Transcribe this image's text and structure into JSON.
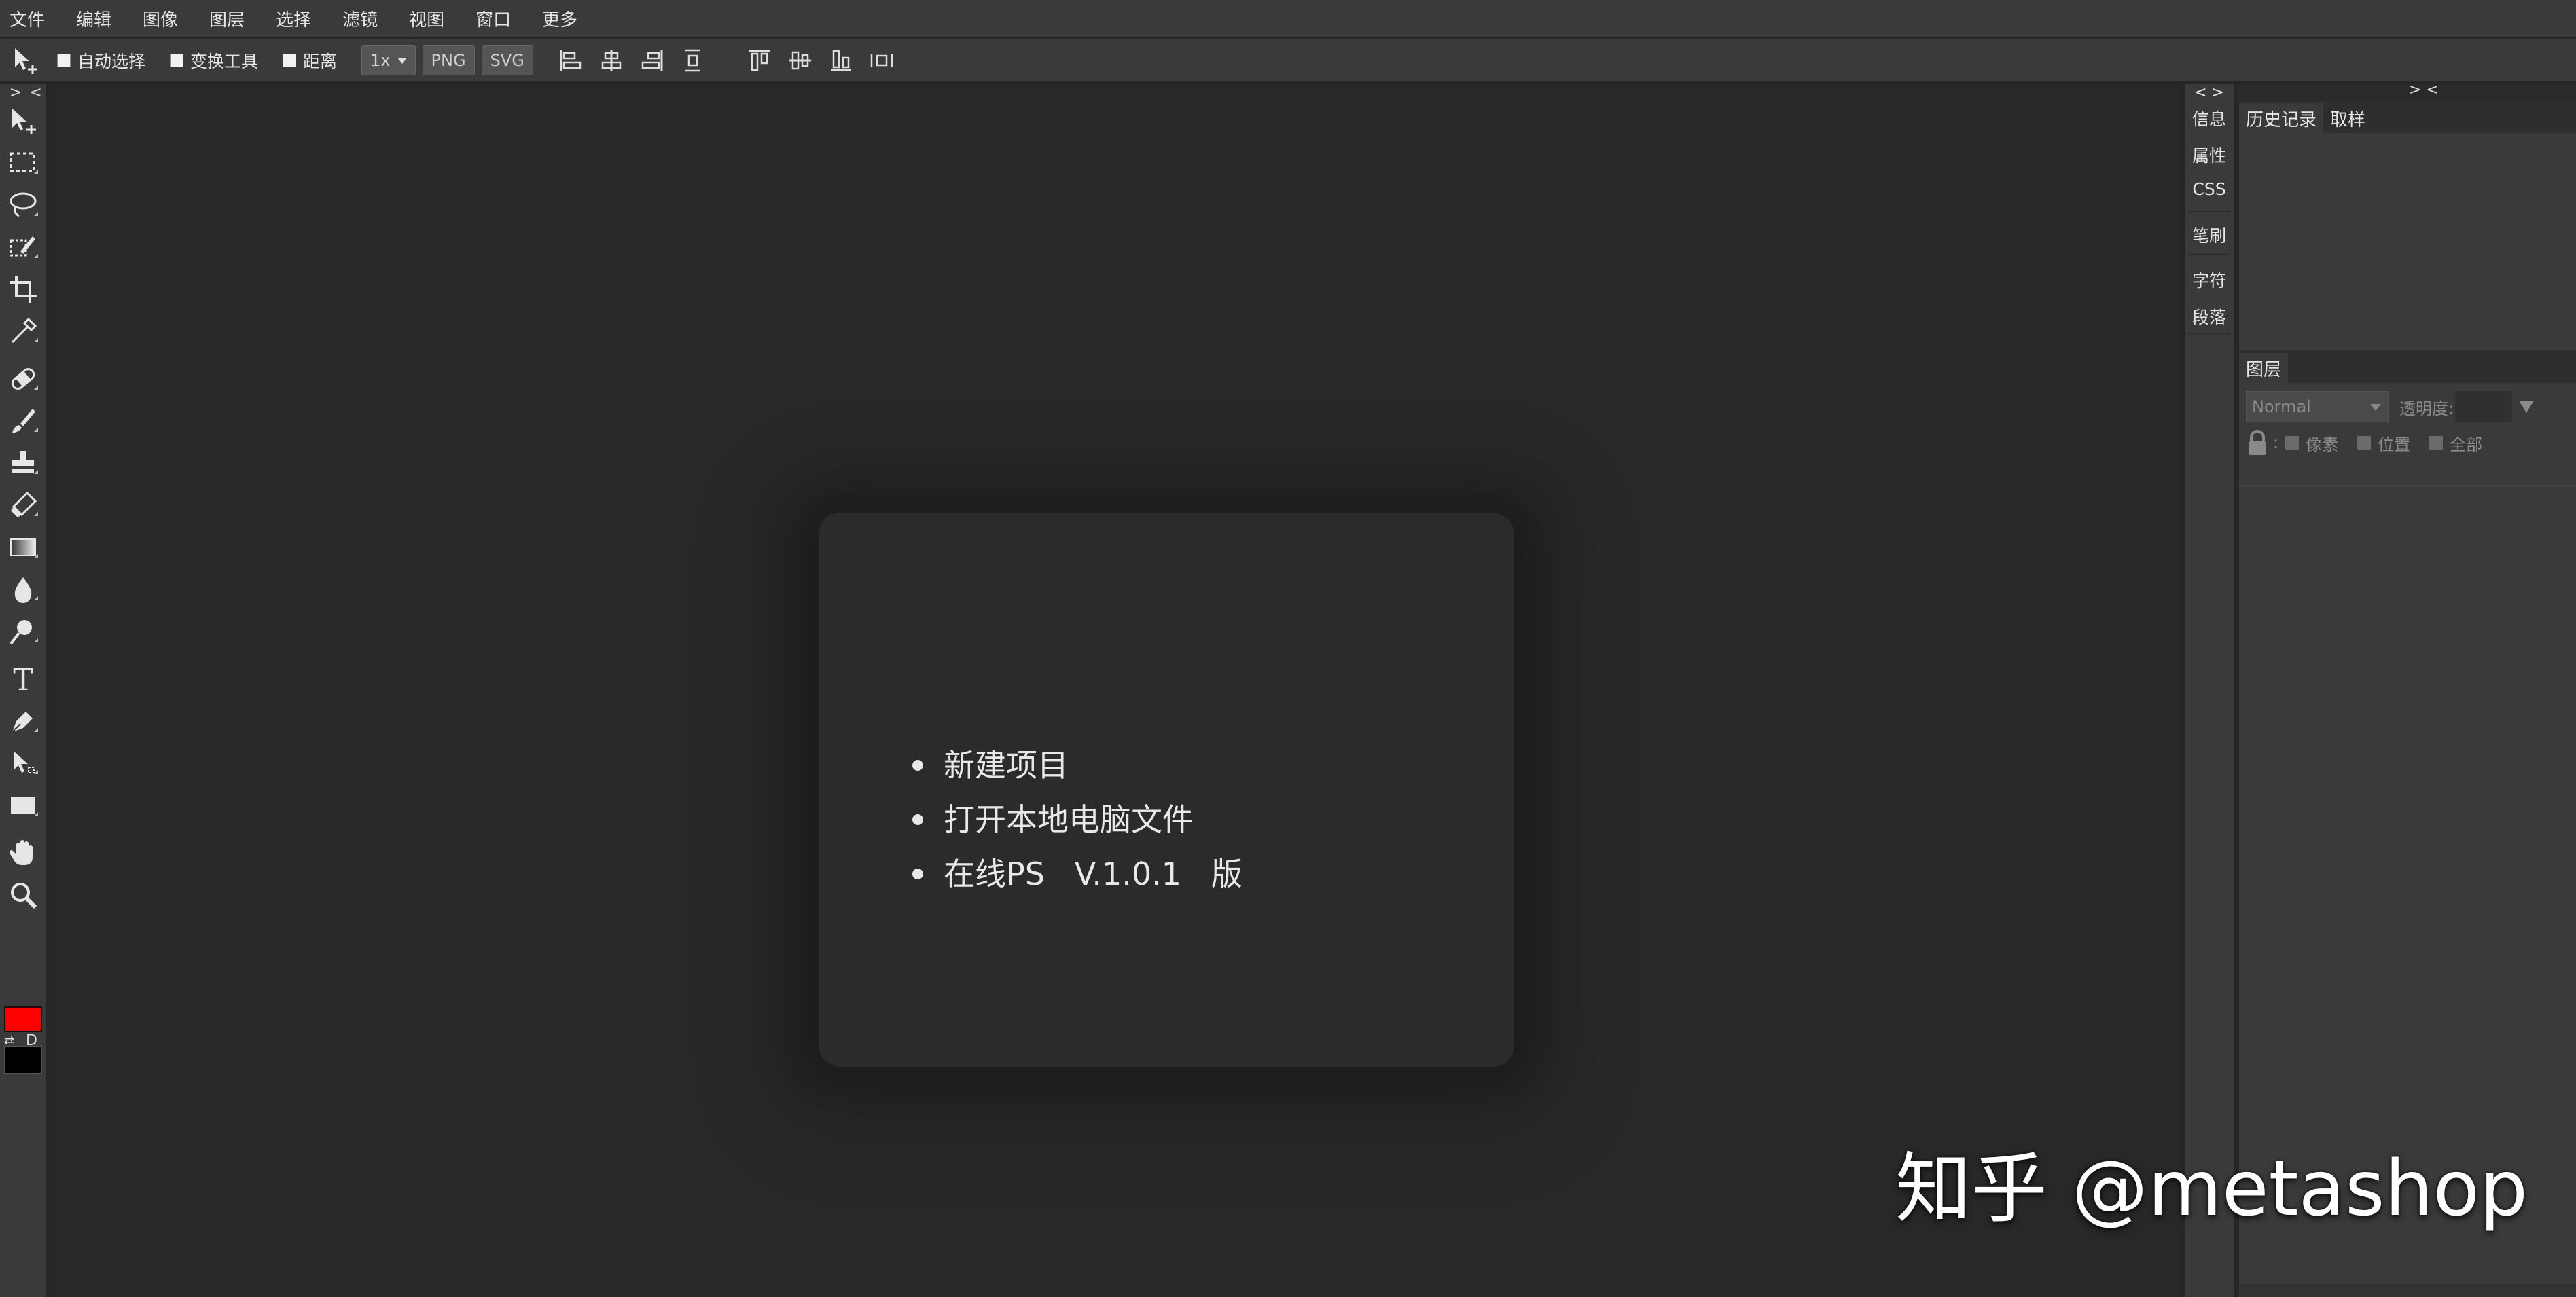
{
  "menu": {
    "items": [
      "文件",
      "编辑",
      "图像",
      "图层",
      "选择",
      "滤镜",
      "视图",
      "窗口",
      "更多"
    ]
  },
  "options_bar": {
    "auto_select": "自动选择",
    "transform_tools": "变换工具",
    "distance": "距离",
    "zoom_select": "1x",
    "export_png": "PNG",
    "export_svg": "SVG"
  },
  "left_toolbar": {
    "collapse_label": "> <",
    "tools": [
      "move-tool",
      "marquee-tool",
      "lasso-tool",
      "quick-selection-tool",
      "crop-tool",
      "eyedropper-tool",
      "healing-brush-tool",
      "brush-tool",
      "clone-stamp-tool",
      "eraser-tool",
      "gradient-tool",
      "blur-tool",
      "dodge-tool",
      "type-tool",
      "pen-tool",
      "path-selection-tool",
      "rectangle-tool",
      "hand-tool",
      "zoom-tool"
    ],
    "type_tool_glyph": "T",
    "foreground_color": "#ff0000",
    "background_color": "#000000",
    "swap_label": "⇄",
    "default_label": "D"
  },
  "start_card": {
    "items": [
      "新建项目",
      "打开本地电脑文件",
      "在线PS   V.1.0.1   版"
    ]
  },
  "panel_tabs": {
    "collapse_label": "< >",
    "info": "信息",
    "properties": "属性",
    "css": "CSS",
    "brush": "笔刷",
    "character": "字符",
    "paragraph": "段落"
  },
  "right_panel": {
    "collapse_label": "> <",
    "history_tab": "历史记录",
    "sample_tab": "取样",
    "layers_tab": "图层",
    "blend_mode": "Normal",
    "opacity_label": "透明度:",
    "lock_pixels": "像素",
    "lock_position": "位置",
    "lock_all": "全部"
  },
  "watermark": "知乎 @metashop"
}
